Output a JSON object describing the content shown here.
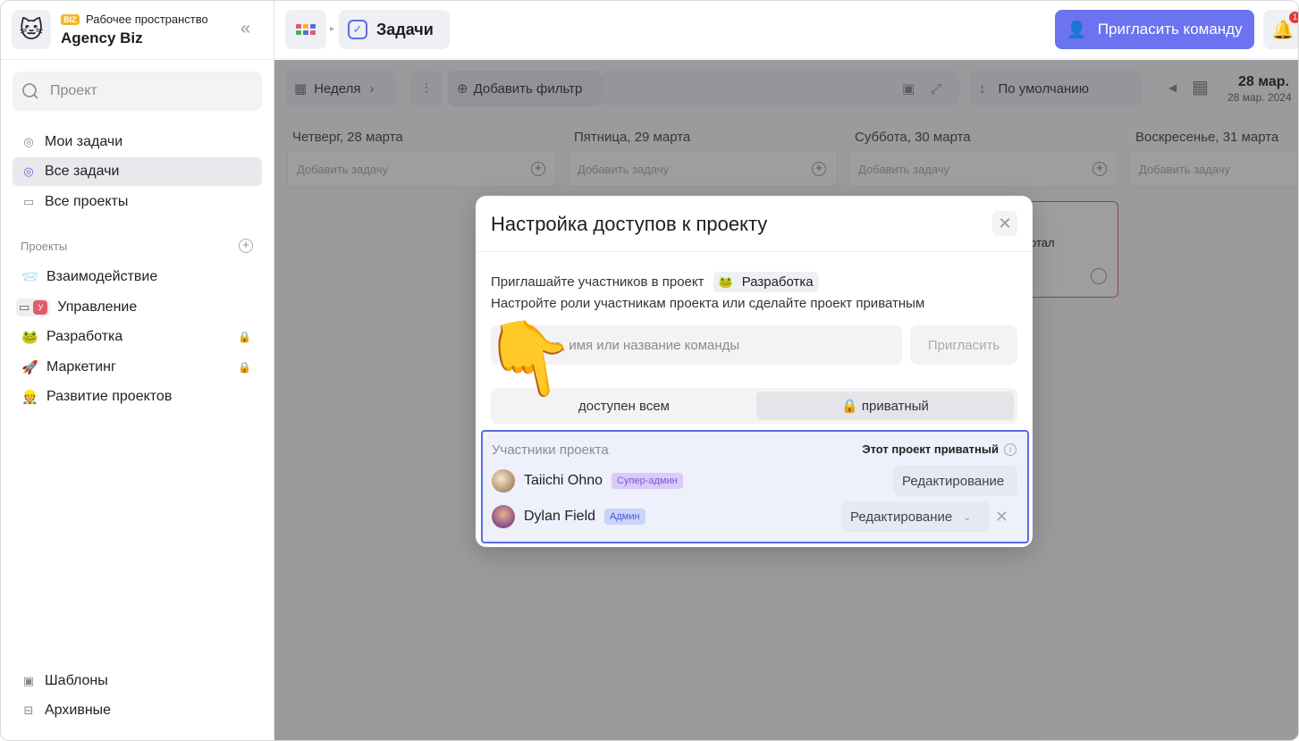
{
  "workspace": {
    "badge": "BIZ",
    "subtitle": "Рабочее пространство",
    "name": "Agency Biz"
  },
  "sidebar": {
    "search_placeholder": "Проект",
    "nav": [
      {
        "label": "Мои задачи",
        "icon": "check-circle-icon"
      },
      {
        "label": "Все задачи",
        "icon": "check-circle-icon",
        "active": true
      },
      {
        "label": "Все проекты",
        "icon": "folder-icon"
      }
    ],
    "projects_title": "Проекты",
    "projects": [
      {
        "label": "Взаимодействие",
        "emoji": "📨",
        "locked": false
      },
      {
        "label": "Управление",
        "emoji": "📁",
        "locked": false,
        "tag": "У"
      },
      {
        "label": "Разработка",
        "emoji": "🐸",
        "locked": true
      },
      {
        "label": "Маркетинг",
        "emoji": "🚀",
        "locked": true
      },
      {
        "label": "Развитие проектов",
        "emoji": "👷",
        "locked": false
      }
    ],
    "footer": [
      {
        "label": "Шаблоны",
        "icon": "templates-icon"
      },
      {
        "label": "Архивные",
        "icon": "archive-icon"
      }
    ]
  },
  "topbar": {
    "breadcrumb": "Задачи",
    "invite_label": "Пригласить команду",
    "notif_count": "1"
  },
  "toolbar": {
    "period": "Неделя",
    "add_filter": "Добавить фильтр",
    "sort": "По умолчанию",
    "date_main": "28 мар.",
    "date_sub": "28 мар. 2024"
  },
  "columns": [
    {
      "title": "Четверг, 28 марта",
      "add": "Добавить задачу"
    },
    {
      "title": "Пятница, 29 марта",
      "add": "Добавить задачу"
    },
    {
      "title": "Суббота, 30 марта",
      "add": "Добавить задачу"
    },
    {
      "title": "Воскресенье, 31 марта",
      "add": "Добавить задачу"
    }
  ],
  "background_card_text": "отал",
  "modal": {
    "title": "Настройка доступов к проекту",
    "invite_text": "Приглашайте участников в проект",
    "project_chip": "Разработка",
    "hint": "Настройте роли участникам проекта или сделайте проект приватным",
    "email_placeholder": "почта, имя или название команды",
    "invite_button": "Пригласить",
    "visibility_public": "доступен всем",
    "visibility_private": "🔒 приватный",
    "members_title": "Участники проекта",
    "private_note": "Этот проект приватный",
    "members": [
      {
        "name": "Taiichi Ohno",
        "role": "Супер-админ",
        "permission": "Редактирование"
      },
      {
        "name": "Dylan Field",
        "role": "Админ",
        "permission": "Редактирование"
      }
    ]
  },
  "colors": {
    "accent": "#6b73f0",
    "selection": "#5b6be0",
    "notif": "#e53935"
  }
}
